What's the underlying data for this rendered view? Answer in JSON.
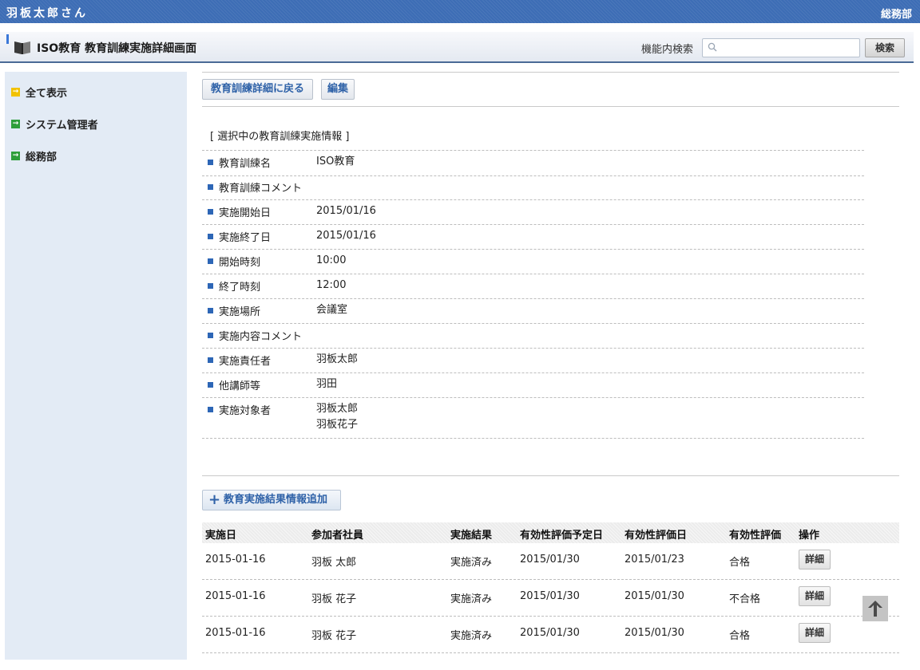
{
  "header": {
    "user_name": "羽板太郎さん",
    "department": "総務部"
  },
  "titlebar": {
    "title": "ISO教育 教育訓練実施詳細画面",
    "search_label": "機能内検索",
    "search_value": "",
    "search_button": "検索"
  },
  "sidebar": {
    "items": [
      {
        "label": "全て表示",
        "color": "#f2c200"
      },
      {
        "label": "システム管理者",
        "color": "#2e9e3a"
      },
      {
        "label": "総務部",
        "color": "#2e9e3a"
      }
    ]
  },
  "actions": {
    "back_label": "教育訓練詳細に戻る",
    "edit_label": "編集"
  },
  "info": {
    "section_title": "[ 選択中の教育訓練実施情報 ]",
    "rows": [
      {
        "label": "教育訓練名",
        "value": "ISO教育"
      },
      {
        "label": "教育訓練コメント",
        "value": ""
      },
      {
        "label": "実施開始日",
        "value": "2015/01/16"
      },
      {
        "label": "実施終了日",
        "value": "2015/01/16"
      },
      {
        "label": "開始時刻",
        "value": "10:00"
      },
      {
        "label": "終了時刻",
        "value": "12:00"
      },
      {
        "label": "実施場所",
        "value": "会議室"
      },
      {
        "label": "実施内容コメント",
        "value": ""
      },
      {
        "label": "実施責任者",
        "value": "羽板太郎"
      },
      {
        "label": "他講師等",
        "value": "羽田"
      },
      {
        "label": "実施対象者",
        "value": "羽板太郎",
        "value2": "羽板花子"
      }
    ]
  },
  "results": {
    "add_label": "教育実施結果情報追加",
    "columns": [
      "実施日",
      "参加者社員",
      "実施結果",
      "有効性評価予定日",
      "有効性評価日",
      "有効性評価",
      "操作"
    ],
    "detail_label": "詳細",
    "rows": [
      [
        "2015-01-16",
        "羽板 太郎",
        "実施済み",
        "2015/01/30",
        "2015/01/23",
        "合格"
      ],
      [
        "2015-01-16",
        "羽板 花子",
        "実施済み",
        "2015/01/30",
        "2015/01/30",
        "不合格"
      ],
      [
        "2015-01-16",
        "羽板 花子",
        "実施済み",
        "2015/01/30",
        "2015/01/30",
        "合格"
      ]
    ]
  },
  "colors": {
    "accent": "#3d6db5",
    "sidebar_bg": "#e3ebf5",
    "link_blue": "#2f62a8"
  },
  "icons": [
    "book-icon",
    "search-icon",
    "arrow-right-icon",
    "plus-icon",
    "arrow-up-icon"
  ]
}
